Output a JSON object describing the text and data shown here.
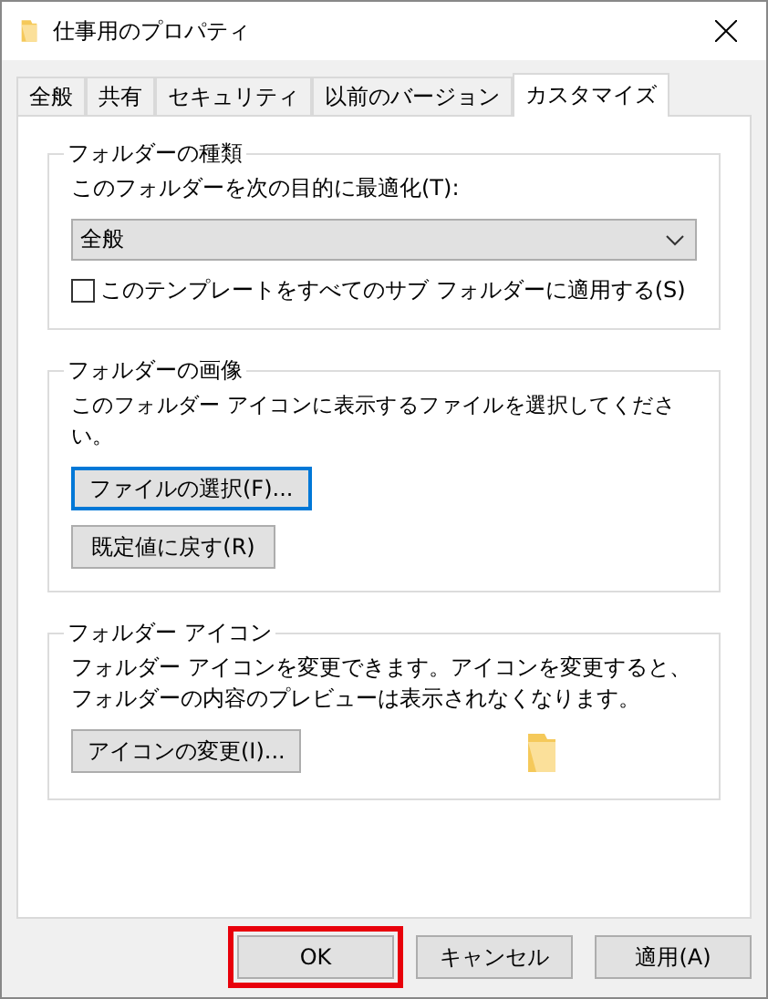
{
  "window": {
    "title": "仕事用のプロパティ"
  },
  "tabs": [
    {
      "label": "全般",
      "selected": false
    },
    {
      "label": "共有",
      "selected": false
    },
    {
      "label": "セキュリティ",
      "selected": false
    },
    {
      "label": "以前のバージョン",
      "selected": false
    },
    {
      "label": "カスタマイズ",
      "selected": true
    }
  ],
  "folder_type": {
    "legend": "フォルダーの種類",
    "label": "このフォルダーを次の目的に最適化(T):",
    "dropdown_value": "全般",
    "checkbox": {
      "label": "このテンプレートをすべてのサブ フォルダーに適用する(S)",
      "checked": false
    }
  },
  "folder_picture": {
    "legend": "フォルダーの画像",
    "description": "このフォルダー アイコンに表示するファイルを選択してください。",
    "buttons": [
      {
        "label": "ファイルの選択(F)...",
        "focused": true
      },
      {
        "label": "既定値に戻す(R)",
        "focused": false
      }
    ]
  },
  "folder_icon": {
    "legend": "フォルダー アイコン",
    "description": "フォルダー アイコンを変更できます。アイコンを変更すると、フォルダーの内容のプレビューは表示されなくなります。",
    "button": "アイコンの変更(I)..."
  },
  "buttons": [
    {
      "label": "OK",
      "highlighted": true
    },
    {
      "label": "キャンセル",
      "highlighted": false
    },
    {
      "label": "適用(A)",
      "highlighted": false
    }
  ]
}
